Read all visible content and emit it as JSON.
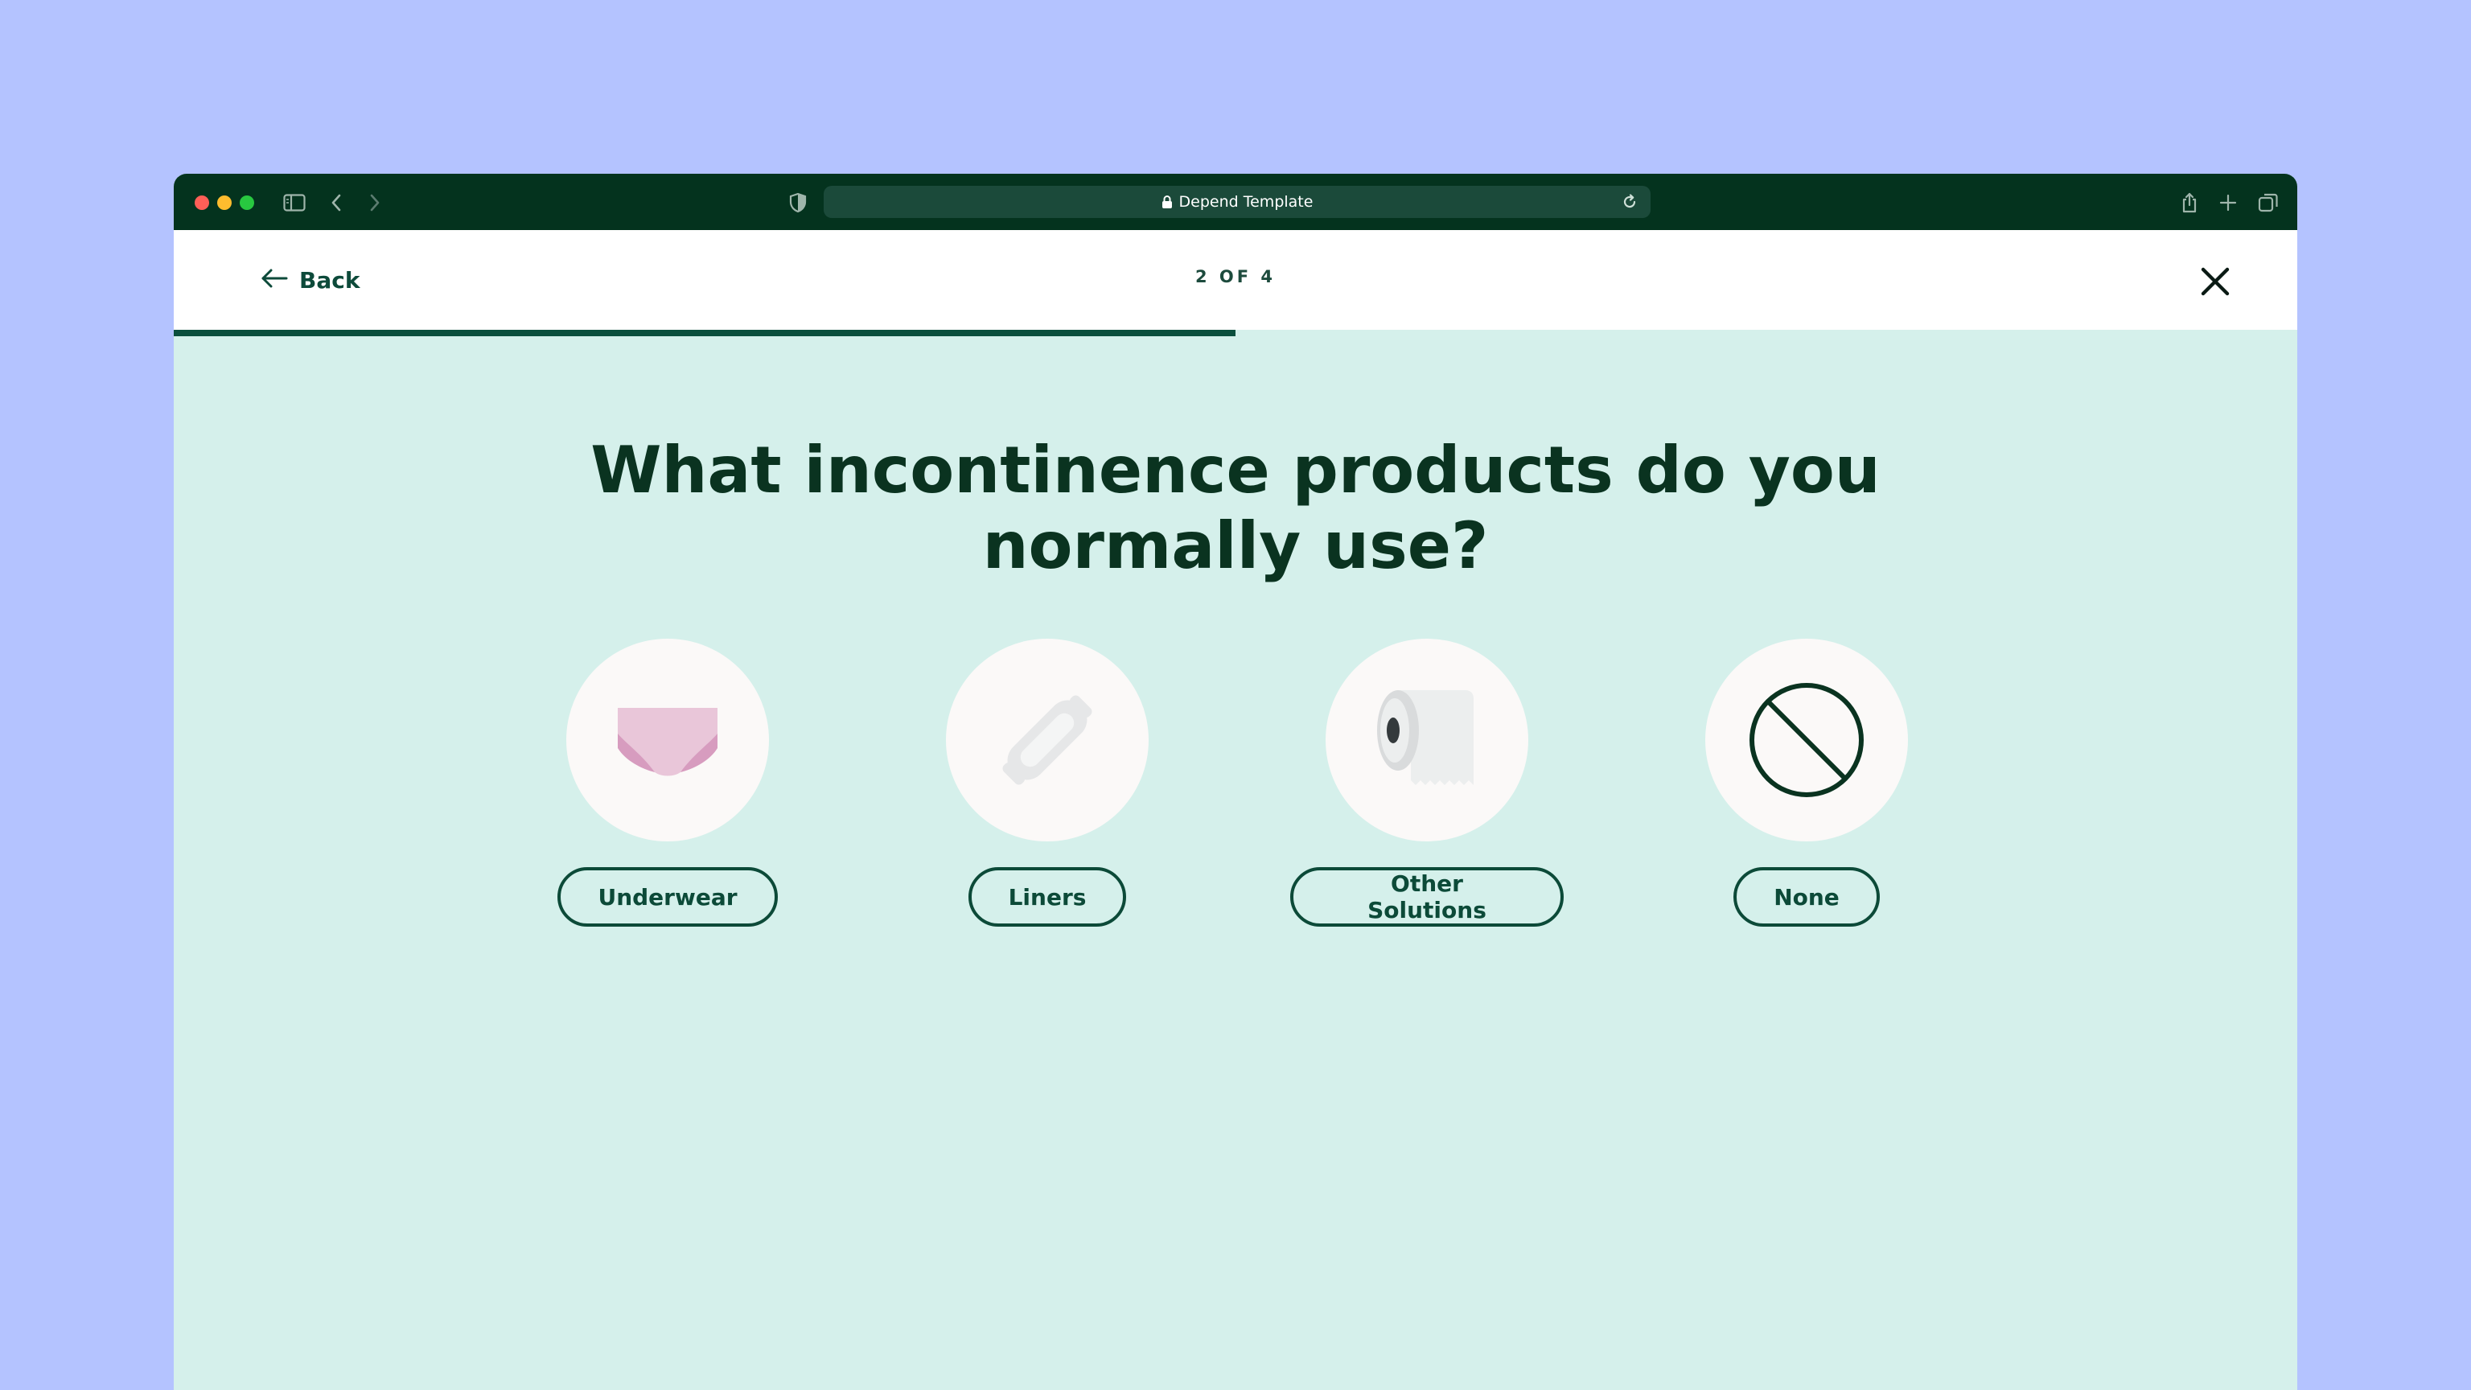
{
  "browser": {
    "url_title": "Depend Template",
    "icons": [
      "sidebar-icon",
      "back-icon",
      "forward-icon",
      "shield-icon",
      "lock-icon",
      "reload-icon",
      "share-icon",
      "plus-icon",
      "tabs-icon"
    ]
  },
  "header": {
    "back_label": "Back",
    "step_indicator": "2 OF 4",
    "progress_fraction": 0.5
  },
  "question": "What incontinence products do you normally use?",
  "options": [
    {
      "label": "Underwear",
      "icon": "underwear-icon"
    },
    {
      "label": "Liners",
      "icon": "liner-icon"
    },
    {
      "label": "Other Solutions",
      "icon": "toilet-paper-icon"
    },
    {
      "label": "None",
      "icon": "no-symbol-icon"
    }
  ],
  "colors": {
    "page_bg": "#b4c3ff",
    "chrome": "#04331e",
    "content_bg": "#d5f0eb",
    "accent": "#0c4a38",
    "heading": "#0a3320"
  }
}
